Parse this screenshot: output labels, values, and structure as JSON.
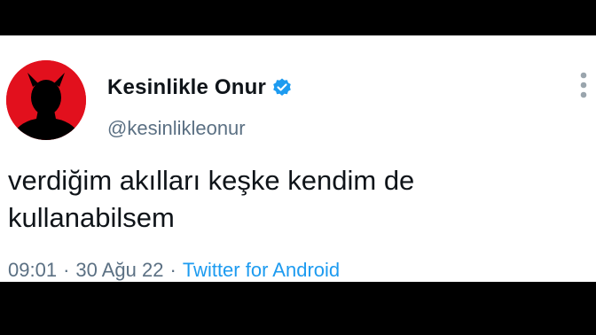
{
  "tweet": {
    "display_name": "Kesinlikle Onur",
    "handle": "@kesinlikleonur",
    "text_line1": "verdiğim akılları keşke kendim de",
    "text_line2": "kullanabilsem",
    "time": "09:01",
    "date": "30 Ağu 22",
    "source": "Twitter for Android",
    "separator": "·"
  },
  "icons": {
    "verified": "verified-badge-icon",
    "more": "more-vertical-icon",
    "avatar": "devil-silhouette-avatar"
  },
  "colors": {
    "avatar_bg": "#e2101d",
    "verified": "#1d9bf0",
    "link": "#1d9bf0",
    "secondary_text": "#5b7083",
    "primary_text": "#0f1419"
  }
}
